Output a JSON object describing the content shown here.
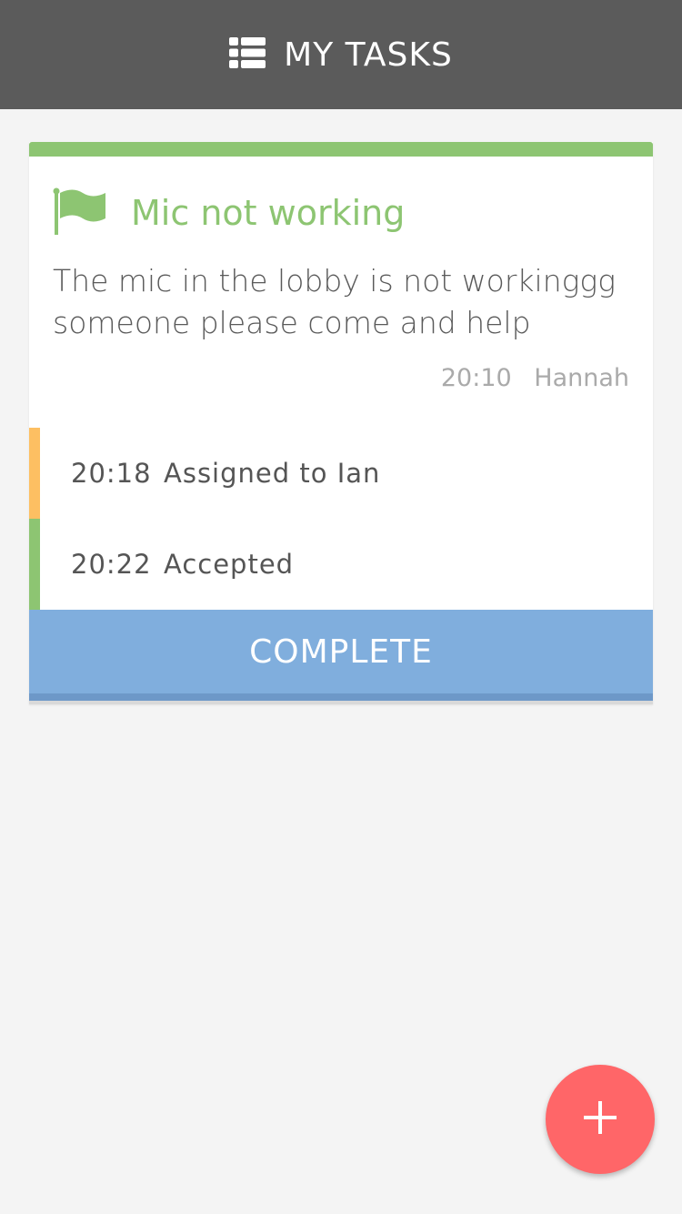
{
  "header": {
    "title": "MY TASKS",
    "icon": "list-icon"
  },
  "task": {
    "icon": "flag-icon",
    "title": "Mic not working",
    "description": "The mic in the lobby is not workinggg someone please come and help",
    "time": "20:10",
    "author": "Hannah",
    "log": [
      {
        "time": "20:18",
        "text": "Assigned to Ian",
        "color": "#fdbf62"
      },
      {
        "time": "20:22",
        "text": "Accepted",
        "color": "#8dc572"
      }
    ],
    "action_label": "COMPLETE"
  },
  "fab": {
    "icon": "plus-icon"
  },
  "colors": {
    "header_bg": "#5b5b5b",
    "accent_green": "#8dc572",
    "accent_orange": "#fdbf62",
    "button_blue": "#80aedd",
    "fab_red": "#ff6668"
  }
}
